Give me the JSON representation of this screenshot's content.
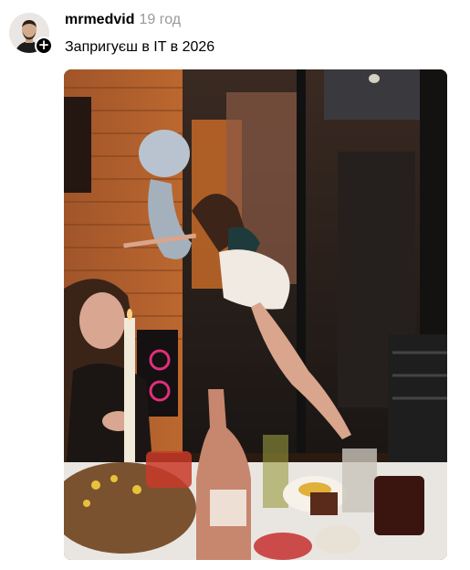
{
  "post": {
    "author": "mrmedvid",
    "timestamp": "19 год",
    "follow_symbol": "+",
    "caption": "Запригуєш в IT в 2026"
  },
  "colors": {
    "text": "#000000",
    "muted": "#999999",
    "background": "#ffffff"
  },
  "icons": {
    "follow": "plus-icon"
  }
}
